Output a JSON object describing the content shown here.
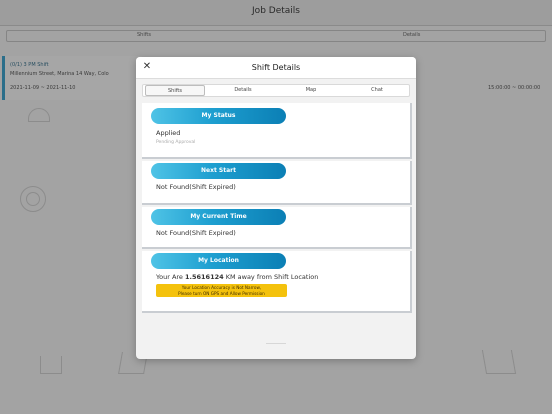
{
  "background": {
    "title": "Job Details",
    "tabs": [
      "Shifts",
      "Details"
    ],
    "shift_card": {
      "title": "(0/1) 3 PM Shift",
      "address": "Millennium Street, Marina 14 Way, Colo",
      "dates": "2021-11-09 ~ 2021-11-10"
    },
    "time_range": "15:00:00 ~ 00:00:00"
  },
  "modal": {
    "title": "Shift Details",
    "close_label": "✕",
    "tabs": [
      {
        "label": "Shifts",
        "active": true
      },
      {
        "label": "Details",
        "active": false
      },
      {
        "label": "Map",
        "active": false
      },
      {
        "label": "Chat",
        "active": false
      }
    ],
    "sections": {
      "status": {
        "heading": "My Status",
        "value": "Applied",
        "sub": "Pending Approval"
      },
      "next_start": {
        "heading": "Next Start",
        "value": "Not Found(Shift Expired)"
      },
      "current_time": {
        "heading": "My Current Time",
        "value": "Not Found(Shift Expired)"
      },
      "location": {
        "heading": "My Location",
        "prefix": "Your Are ",
        "distance": "1.5616124",
        "suffix": " KM away from Shift Location",
        "warning_line1": "Your Location Accuracy is Not Narrow,",
        "warning_line2": "Please turn ON GPS and Allow Permission"
      }
    }
  },
  "colors": {
    "pill_start": "#4fc3e6",
    "pill_end": "#0b7fb5",
    "warning": "#f4c20d",
    "overlay": "#a3a3a3"
  }
}
